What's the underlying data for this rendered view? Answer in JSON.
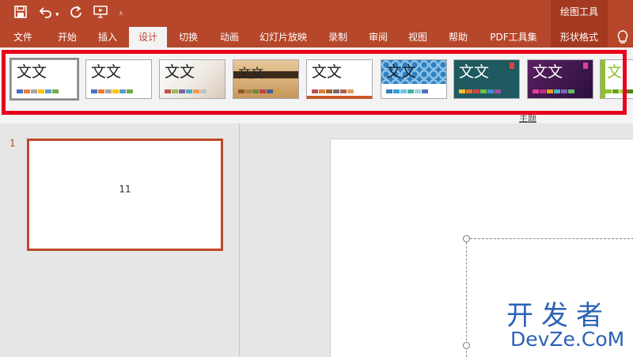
{
  "quick_access": {
    "save_icon": "save-icon",
    "undo_icon": "undo-icon",
    "undo_dropdown_icon": "chevron-down-icon",
    "redo_icon": "redo-icon",
    "presentation_icon": "start-from-beginning-icon",
    "customize_icon": "customize-quick-access-icon"
  },
  "context_title": "绘图工具",
  "tabs": [
    {
      "label": "文件"
    },
    {
      "label": "开始"
    },
    {
      "label": "插入"
    },
    {
      "label": "设计",
      "active": true
    },
    {
      "label": "切换"
    },
    {
      "label": "动画"
    },
    {
      "label": "幻灯片放映"
    },
    {
      "label": "录制"
    },
    {
      "label": "审阅"
    },
    {
      "label": "视图"
    },
    {
      "label": "帮助"
    },
    {
      "label": "PDF工具集"
    },
    {
      "label": "形状格式",
      "contextual": true
    }
  ],
  "tell_me_icon": "lightbulb-icon",
  "ribbon": {
    "group_label": "主题",
    "themes": [
      {
        "text": "文文",
        "style": "office",
        "colors": [
          "#4472c4",
          "#ed7d31",
          "#a5a5a5",
          "#ffc000",
          "#5b9bd5",
          "#70ad47"
        ]
      },
      {
        "text": "文文",
        "style": "office-2013",
        "colors": [
          "#4472c4",
          "#ed7d31",
          "#a5a5a5",
          "#ffc000",
          "#5b9bd5",
          "#70ad47"
        ]
      },
      {
        "text": "文文",
        "style": "faceted",
        "colors": [
          "#c0504d",
          "#9bbb59",
          "#8064a2",
          "#4bacc6",
          "#f79646",
          "#c0c0c0"
        ]
      },
      {
        "text": "文文",
        "style": "wood",
        "colors": [
          "#8b5a2b",
          "#b08040",
          "#6d8a3a",
          "#c04040",
          "#4060a0",
          "#d0a040"
        ]
      },
      {
        "text": "文文",
        "style": "retrospect",
        "colors": [
          "#c0504d",
          "#d88040",
          "#a06030",
          "#707070",
          "#b06050",
          "#e0a060"
        ]
      },
      {
        "text": "文文",
        "style": "circuit",
        "colors": [
          "#2f7fc1",
          "#3a9bd5",
          "#70c1e0",
          "#48b0a0",
          "#a0d0e0",
          "#5070c0"
        ]
      },
      {
        "text": "文文",
        "style": "ion",
        "colors": [
          "#f2c12e",
          "#e8702a",
          "#e04040",
          "#6cc04a",
          "#4090d0",
          "#a050a0"
        ]
      },
      {
        "text": "文文",
        "style": "ion-boardroom",
        "colors": [
          "#e040a0",
          "#c03080",
          "#f0a020",
          "#50b0d0",
          "#8060c0",
          "#60c060"
        ]
      },
      {
        "text": "文",
        "style": "facet",
        "colors": [
          "#90c030",
          "#70a020",
          "#b0d040",
          "#508010"
        ]
      }
    ]
  },
  "thumbnail_pane": {
    "slide_number": "1",
    "slide_text": "11"
  },
  "watermark": {
    "line1": "开发者",
    "line2": "DevZe.CoM"
  }
}
